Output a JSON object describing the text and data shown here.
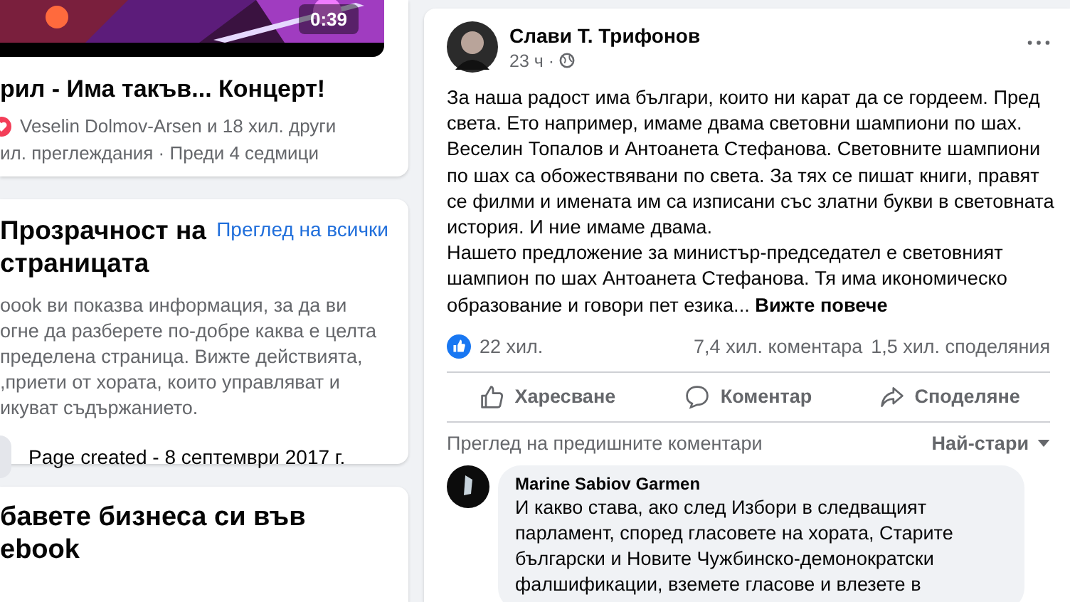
{
  "video_card": {
    "duration": "0:39",
    "title": "рил - Има такъв... Концерт!",
    "reactions": "Veselin Dolmov-Arsen и 18 хил. други",
    "meta": "ил. преглеждания · Преди 4 седмици"
  },
  "transparency_card": {
    "title_lines": [
      "Прозрачност на",
      "страницата"
    ],
    "see_all": "Преглед на всички",
    "description_lines": [
      "oook ви показва информация, за да ви",
      "огне да разберете по-добре каква е целта",
      "пределена страница. Вижте действията,",
      ",приети от хората, които управляват и",
      "икуват съдържанието."
    ],
    "page_created": "Page created - 8 септември 2017 г."
  },
  "business_card": {
    "title_lines": [
      "бавете бизнеса си във",
      "ebook"
    ]
  },
  "post": {
    "author": "Слави Т. Трифонов",
    "time": "23 ч ·",
    "body_lines": [
      "За наша радост има българи, които ни карат да се гордеем. Пред",
      "света. Ето например, имаме двама световни шампиони по шах.",
      "Веселин Топалов и Антоанета Стефанова. Световните шампиони",
      "по шах са обожествявани по света. За тях се пишат книги, правят",
      "се филми и имената им са изписани със златни букви в световната",
      "история. И ние имаме двама.",
      "Нашето предложение за министър-председател е световният",
      "шампион по шах Антоанета Стефанова. Тя има икономическо",
      "образование и говори пет езика..."
    ],
    "see_more": "Вижте повече",
    "likes": "22 хил.",
    "comments_count": "7,4 хил. коментара",
    "shares_count": "1,5 хил. споделяния",
    "actions": [
      {
        "kind": "like",
        "label": "Харесване"
      },
      {
        "kind": "comment",
        "label": "Коментар"
      },
      {
        "kind": "share",
        "label": "Споделяне"
      }
    ],
    "previous_comments": "Преглед на предишните коментари",
    "sort": "Най-стари",
    "comment": {
      "author": "Marine Sabiov Garmen",
      "lines": [
        "И какво става, ако след Избори в следващият",
        "парламент, според гласовете на хората, Старите",
        "български и Новите Чужбинско-демонократски",
        "фалшификации, вземете гласове и влезете в"
      ]
    }
  }
}
